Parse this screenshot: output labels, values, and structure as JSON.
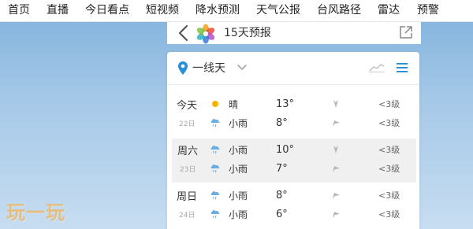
{
  "topnav": {
    "items": [
      {
        "label": "首页"
      },
      {
        "label": "直播"
      },
      {
        "label": "今日看点"
      },
      {
        "label": "短视频"
      },
      {
        "label": "降水预测"
      },
      {
        "label": "天气公报"
      },
      {
        "label": "台风路径"
      },
      {
        "label": "雷达"
      },
      {
        "label": "预警"
      }
    ]
  },
  "header": {
    "title": "15天预报",
    "back_icon": "chevron-left-icon",
    "logo_icon": "colorful-flower-logo",
    "share_icon": "share-icon"
  },
  "card": {
    "city": "一线天",
    "chevron_icon": "chevron-down-icon",
    "chart_icon": "trend-chart-icon",
    "list_icon": "list-icon"
  },
  "days": [
    {
      "name": "今天",
      "date": "22日",
      "day": {
        "icon": "sunny-icon",
        "weather": "晴",
        "temp": "13°",
        "wind": "<3级"
      },
      "night": {
        "icon": "light-rain-icon",
        "weather": "小雨",
        "temp": "8°",
        "wind": "<3级"
      }
    },
    {
      "name": "周六",
      "date": "23日",
      "day": {
        "icon": "light-rain-icon",
        "weather": "小雨",
        "temp": "10°",
        "wind": "<3级"
      },
      "night": {
        "icon": "light-rain-icon",
        "weather": "小雨",
        "temp": "7°",
        "wind": "<3级"
      }
    },
    {
      "name": "周日",
      "date": "24日",
      "day": {
        "icon": "light-rain-icon",
        "weather": "小雨",
        "temp": "8°",
        "wind": "<3级"
      },
      "night": {
        "icon": "light-rain-icon",
        "weather": "小雨",
        "temp": "6°",
        "wind": "<3级"
      }
    }
  ],
  "watermark": "玩一玩",
  "colors": {
    "accent_blue": "#2a8fd6",
    "sun": "#f6b400",
    "rain_cloud": "#6aaedf",
    "wind_arrow": "#b5b5b5",
    "alt_row_bg": "#f0f0f0"
  }
}
